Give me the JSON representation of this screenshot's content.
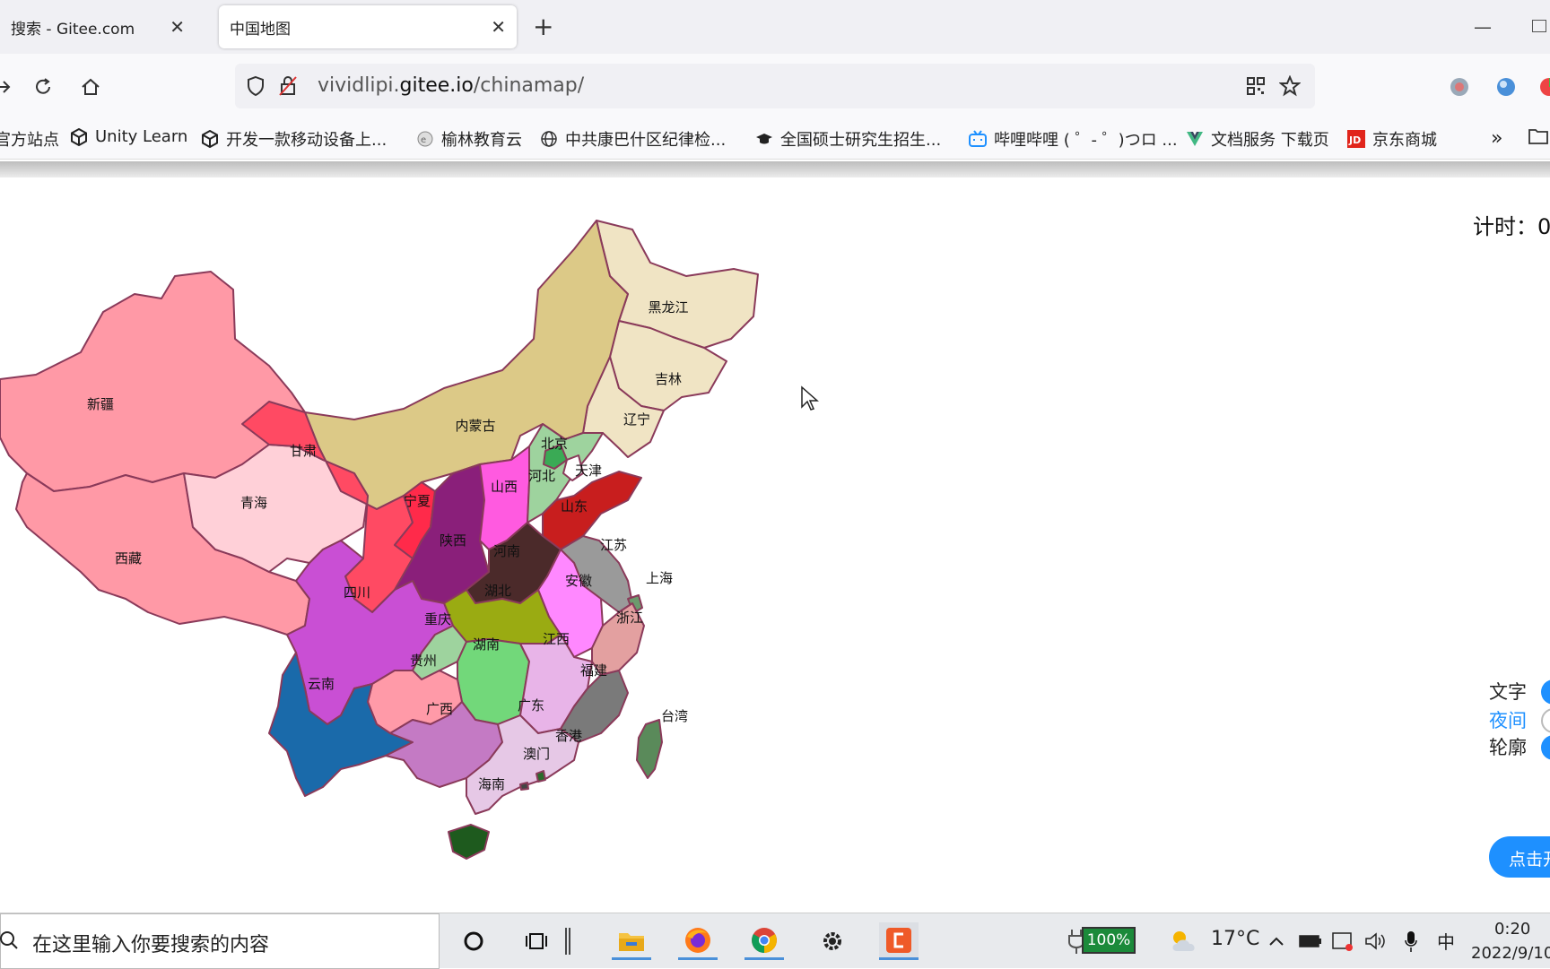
{
  "tabs": [
    {
      "label": "搜索 - Gitee.com"
    },
    {
      "label": "中国地图",
      "active": true
    }
  ],
  "address": {
    "prefix": "vividlipi.",
    "host": "gitee.io",
    "path": "/chinamap/"
  },
  "bookmarks": [
    {
      "label": "官方站点"
    },
    {
      "label": "Unity Learn"
    },
    {
      "label": "开发一款移动设备上..."
    },
    {
      "label": "榆林教育云"
    },
    {
      "label": "中共康巴什区纪律检..."
    },
    {
      "label": "全国硕士研究生招生..."
    },
    {
      "label": "哔哩哔哩 ( ゜- ゜)つロ ..."
    },
    {
      "label": "文档服务 下载页"
    },
    {
      "label": "京东商城"
    }
  ],
  "page": {
    "timer_label": "计时：0",
    "controls": {
      "text": "文字",
      "night": "夜间",
      "outline": "轮廓",
      "start": "点击开始"
    },
    "provinces": [
      {
        "id": "heilongjiang",
        "name": "黑龙江",
        "color": "#f0e4c4"
      },
      {
        "id": "jilin",
        "name": "吉林",
        "color": "#f0e4c4"
      },
      {
        "id": "liaoning",
        "name": "辽宁",
        "color": "#f0e4c4"
      },
      {
        "id": "neimenggu",
        "name": "内蒙古",
        "color": "#dcc987"
      },
      {
        "id": "xinjiang",
        "name": "新疆",
        "color": "#ff99a6"
      },
      {
        "id": "xizang",
        "name": "西藏",
        "color": "#ff99a6"
      },
      {
        "id": "qinghai",
        "name": "青海",
        "color": "#ffd0d8"
      },
      {
        "id": "gansu",
        "name": "甘肃",
        "color": "#ff4a63"
      },
      {
        "id": "ningxia",
        "name": "宁夏",
        "color": "#ff2a4a"
      },
      {
        "id": "shaanxi",
        "name": "陕西",
        "color": "#8a1f7a"
      },
      {
        "id": "shanxi",
        "name": "山西",
        "color": "#ff5ae0"
      },
      {
        "id": "hebei",
        "name": "河北",
        "color": "#9ed39e"
      },
      {
        "id": "beijing",
        "name": "北京",
        "color": "#3aaa55"
      },
      {
        "id": "tianjin",
        "name": "天津",
        "color": "#ffffff"
      },
      {
        "id": "shandong",
        "name": "山东",
        "color": "#c81e1e"
      },
      {
        "id": "henan",
        "name": "河南",
        "color": "#4b2a2a"
      },
      {
        "id": "jiangsu",
        "name": "江苏",
        "color": "#9a9a9a"
      },
      {
        "id": "shanghai",
        "name": "上海",
        "color": "#6d9a6d"
      },
      {
        "id": "anhui",
        "name": "安徽",
        "color": "#ff88ff"
      },
      {
        "id": "zhejiang",
        "name": "浙江",
        "color": "#e3a0a0"
      },
      {
        "id": "hubei",
        "name": "湖北",
        "color": "#9aab12"
      },
      {
        "id": "sichuan",
        "name": "四川",
        "color": "#c94fd4"
      },
      {
        "id": "chongqing",
        "name": "重庆",
        "color": "#9ed39e"
      },
      {
        "id": "hunan",
        "name": "湖南",
        "color": "#72d87a"
      },
      {
        "id": "jiangxi",
        "name": "江西",
        "color": "#e8b4e8"
      },
      {
        "id": "fujian",
        "name": "福建",
        "color": "#7a7a7a"
      },
      {
        "id": "guizhou",
        "name": "贵州",
        "color": "#ff9aa8"
      },
      {
        "id": "yunnan",
        "name": "云南",
        "color": "#1a6aaa"
      },
      {
        "id": "guangxi",
        "name": "广西",
        "color": "#c47ac4"
      },
      {
        "id": "guangdong",
        "name": "广东",
        "color": "#e6c8e6"
      },
      {
        "id": "xianggang",
        "name": "香港",
        "color": "#2a6a2a"
      },
      {
        "id": "aomen",
        "name": "澳门",
        "color": "#444444"
      },
      {
        "id": "hainan",
        "name": "海南",
        "color": "#1e5a1e"
      },
      {
        "id": "taiwan",
        "name": "台湾",
        "color": "#5a8a5a"
      }
    ]
  },
  "taskbar": {
    "search_placeholder": "在这里输入你要搜索的内容",
    "battery": "100%",
    "temperature": "17°C",
    "ime": "中",
    "time": "0:20",
    "date": "2022/9/10"
  }
}
